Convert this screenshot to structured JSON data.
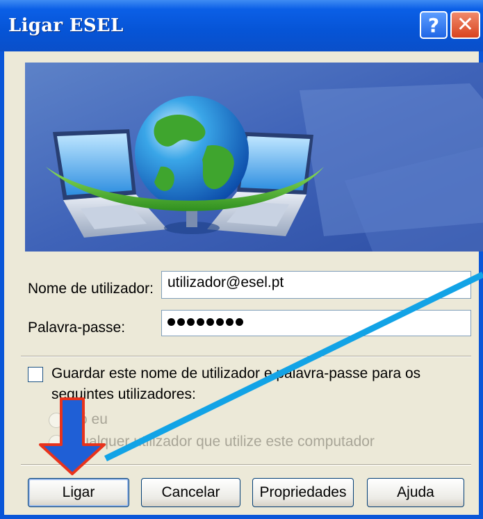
{
  "window": {
    "title": "Ligar ESEL"
  },
  "titlebar_buttons": {
    "help_label": "?",
    "close_label": "✕"
  },
  "form": {
    "username_label": "Nome de utilizador:",
    "username_value": "utilizador@esel.pt",
    "password_label": "Palavra-passe:",
    "password_mask_count": 8,
    "save_checkbox_label_line1": "Guardar este nome de utilizador e palavra-passe para os",
    "save_checkbox_label_line2": "seguintes utilizadores:",
    "save_checked": false,
    "radio_only_me": "Só eu",
    "radio_anyone": "Qualquer utilizador que utilize este computador"
  },
  "buttons": {
    "connect": "Ligar",
    "cancel": "Cancelar",
    "properties": "Propriedades",
    "help": "Ajuda"
  },
  "annotations": {
    "arrow_color": "#1f5fd6",
    "pointer_line_color": "#12a3e6",
    "arrow_outline_color": "#e8331c"
  }
}
